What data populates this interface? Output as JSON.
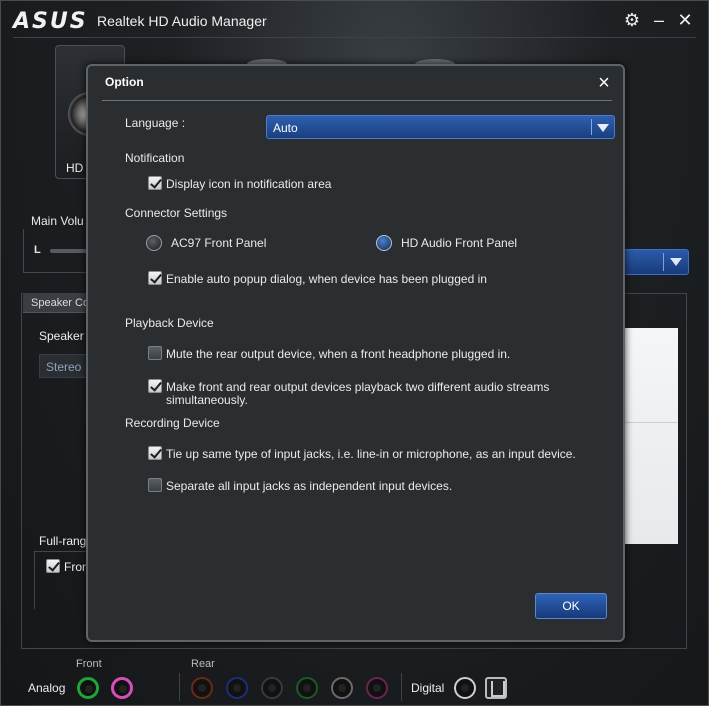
{
  "window": {
    "brand": "ASUS",
    "title": "Realtek HD Audio Manager"
  },
  "background": {
    "hd_tile_label": "HD",
    "main_volume_label": "Main Volu",
    "volume_left": "L",
    "speaker_tab_label": "Speaker Co",
    "speaker_config_label": "Speaker C",
    "stereo_value": "Stereo",
    "full_range_label": "Full-rang",
    "front_checkbox_label": "Fron",
    "front_checkbox_checked": true
  },
  "jacks": {
    "analog_label": "Analog",
    "front_label": "Front",
    "rear_label": "Rear",
    "digital_label": "Digital",
    "front_colors": [
      "#1fa33a",
      "#d44fbd"
    ],
    "rear_colors": [
      "#b8441f",
      "#1d3aa8",
      "#3a3a3a",
      "#1f8a35",
      "#8a8a8a",
      "#a3306f"
    ]
  },
  "dialog": {
    "title": "Option",
    "language_label": "Language :",
    "language_value": "Auto",
    "notification_heading": "Notification",
    "display_icon_label": "Display icon in notification area",
    "display_icon_checked": true,
    "connector_heading": "Connector Settings",
    "radio_ac97_label": "AC97 Front Panel",
    "radio_hd_label": "HD Audio Front Panel",
    "connector_selected": "HD Audio Front Panel",
    "auto_popup_label": "Enable auto popup dialog, when device has been plugged in",
    "auto_popup_checked": true,
    "playback_heading": "Playback Device",
    "mute_rear_label": "Mute the rear output device, when a front headphone plugged in.",
    "mute_rear_checked": false,
    "two_streams_label_line1": "Make front and rear output devices playback two different audio streams",
    "two_streams_label_line2": "simultaneously.",
    "two_streams_checked": true,
    "recording_heading": "Recording Device",
    "tie_up_label": "Tie up same type of input jacks, i.e. line-in or microphone, as an input device.",
    "tie_up_checked": true,
    "separate_label": "Separate all input jacks as independent input devices.",
    "separate_checked": false,
    "ok_label": "OK"
  }
}
